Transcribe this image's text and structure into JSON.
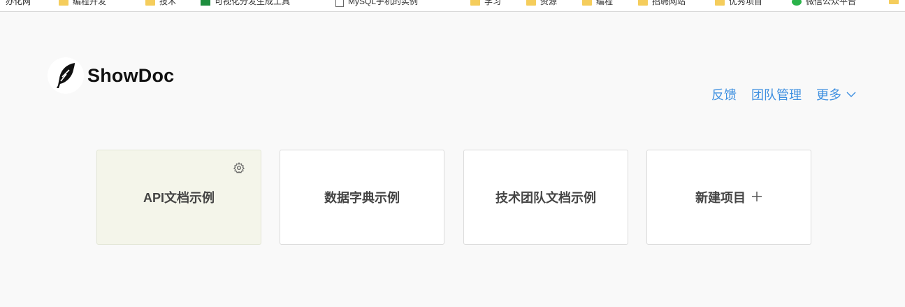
{
  "bookmarks": [
    {
      "label": "办化网",
      "icon": "folder-icon"
    },
    {
      "label": "编程开发",
      "icon": "folder-icon"
    },
    {
      "label": "技术",
      "icon": "folder-icon"
    },
    {
      "label": "可视化分发生成工具",
      "icon": "sheets-icon"
    },
    {
      "label": "MySQL手机的实例",
      "icon": "page-icon"
    },
    {
      "label": "学习",
      "icon": "folder-icon"
    },
    {
      "label": "资源",
      "icon": "folder-icon"
    },
    {
      "label": "编程",
      "icon": "folder-icon"
    },
    {
      "label": "招聘网站",
      "icon": "folder-icon"
    },
    {
      "label": "优秀项目",
      "icon": "folder-icon"
    },
    {
      "label": "微信公众平台",
      "icon": "wechat-icon"
    }
  ],
  "header": {
    "brand": "ShowDoc",
    "nav": {
      "feedback": "反馈",
      "team": "团队管理",
      "more": "更多"
    }
  },
  "projects": [
    {
      "label": "API文档示例"
    },
    {
      "label": "数据字典示例"
    },
    {
      "label": "技术团队文档示例"
    }
  ],
  "new_project": {
    "label": "新建项目",
    "icon": "plus-icon"
  },
  "colors": {
    "accent": "#3d8fe0",
    "background": "#f9f9f9",
    "active_card": "#f4f5ea"
  }
}
